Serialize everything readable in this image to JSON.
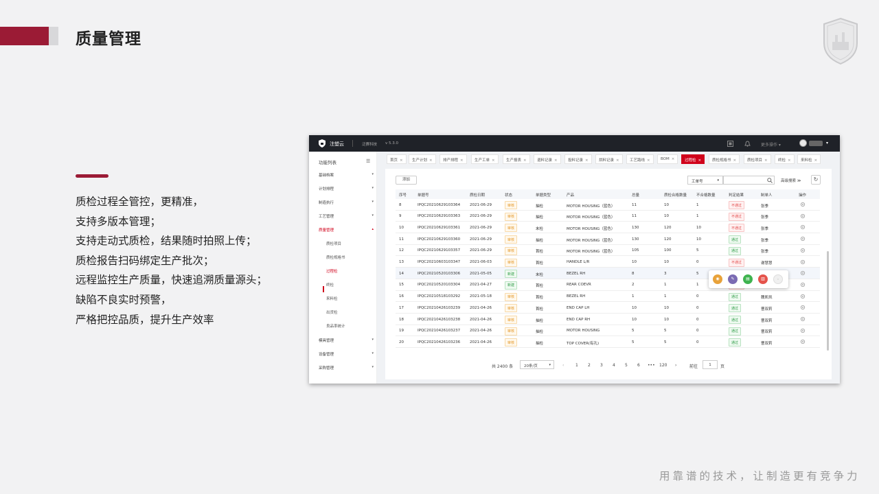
{
  "slide": {
    "title": "质量管理",
    "bullets": [
      "质检过程全管控，更精准，",
      "支持多版本管理；",
      "支持走动式质检，结果随时拍照上传；",
      "质检报告扫码绑定生产批次；",
      "远程监控生产质量，快速追溯质量源头；",
      "缺陷不良实时预警，",
      "严格把控品质，提升生产效率"
    ],
    "slogan": "用靠谱的技术，让制造更有竞争力",
    "accent_color": "#9b1b35"
  },
  "app": {
    "brand": "注塑云",
    "company": "泛赛科技",
    "version": "v 5.3.0",
    "more_actions": "更多操作 ▾",
    "sidebar": {
      "header": "功能列表",
      "fold_icon": "menu-fold-icon",
      "items": [
        "基础档案",
        "计划排程",
        "制造执行",
        "工艺管理",
        "质量管理"
      ],
      "quality_sub": [
        "质检项目",
        "质检规格书",
        "过程检",
        "终检",
        "来料检",
        "出货检",
        "良品率统计"
      ],
      "items_after": [
        "模具管理",
        "设备管理",
        "采购管理"
      ]
    },
    "tabs": [
      "首页",
      "生产计划",
      "排产排程",
      "生产工单",
      "生产报表",
      "退料记录",
      "投料记录",
      "烘料记录",
      "工艺路线",
      "BOM",
      "过程检",
      "质检规格书",
      "质检项目",
      "终检",
      "来料检"
    ],
    "active_tab": "过程检",
    "toolbar": {
      "add_label": "添加",
      "filter_field": "工单号",
      "advanced_search": "高级搜索  ≫"
    },
    "columns": [
      "序号",
      "单据号",
      "质检日期",
      "状态",
      "单据类型",
      "产品",
      "总量",
      "质检合格数量",
      "不合格数量",
      "判定结果",
      "制单人",
      "操作"
    ],
    "rows": [
      {
        "no": "8",
        "doc": "IPQC20210629103364",
        "date": "2021-06-29",
        "status": "审核",
        "type": "抽检",
        "product": "MOTOR HOUSING（蓝色）",
        "total": "11",
        "pass": "10",
        "fail": "1",
        "result": "不通过",
        "maker": "张季"
      },
      {
        "no": "9",
        "doc": "IPQC20210629103363",
        "date": "2021-06-29",
        "status": "审核",
        "type": "抽检",
        "product": "MOTOR HOUSING（蓝色）",
        "total": "11",
        "pass": "10",
        "fail": "1",
        "result": "不通过",
        "maker": "张季"
      },
      {
        "no": "10",
        "doc": "IPQC20210629103361",
        "date": "2021-06-29",
        "status": "审核",
        "type": "末检",
        "product": "MOTOR HOUSING（蓝色）",
        "total": "130",
        "pass": "120",
        "fail": "10",
        "result": "不通过",
        "maker": "张季"
      },
      {
        "no": "11",
        "doc": "IPQC20210629103360",
        "date": "2021-06-29",
        "status": "审核",
        "type": "抽检",
        "product": "MOTOR HOUSING（蓝色）",
        "total": "130",
        "pass": "120",
        "fail": "10",
        "result": "通过",
        "maker": "张季"
      },
      {
        "no": "12",
        "doc": "IPQC20210629103357",
        "date": "2021-06-29",
        "status": "审核",
        "type": "首检",
        "product": "MOTOR HOUSING（蓝色）",
        "total": "105",
        "pass": "100",
        "fail": "5",
        "result": "通过",
        "maker": "张季"
      },
      {
        "no": "13",
        "doc": "IPQC20210603103347",
        "date": "2021-06-03",
        "status": "审核",
        "type": "首检",
        "product": "HANDLE L/R",
        "total": "10",
        "pass": "10",
        "fail": "0",
        "result": "不通过",
        "maker": "谢慧慧"
      },
      {
        "no": "14",
        "doc": "IPQC20210520103306",
        "date": "2021-05-05",
        "status": "新建",
        "type": "末检",
        "product": "BEZEL RH",
        "total": "8",
        "pass": "3",
        "fail": "5",
        "result": "",
        "maker": ""
      },
      {
        "no": "15",
        "doc": "IPQC20210520103304",
        "date": "2021-04-27",
        "status": "新建",
        "type": "首检",
        "product": "REAR COEVR",
        "total": "2",
        "pass": "1",
        "fail": "1",
        "result": "不通过",
        "maker": "孙文军"
      },
      {
        "no": "16",
        "doc": "IPQC20210518103292",
        "date": "2021-05-18",
        "status": "审核",
        "type": "首检",
        "product": "BEZEL RH",
        "total": "1",
        "pass": "1",
        "fail": "0",
        "result": "通过",
        "maker": "魏凯凯"
      },
      {
        "no": "17",
        "doc": "IPQC20210426103239",
        "date": "2021-04-26",
        "status": "审核",
        "type": "首检",
        "product": "END CAP LH",
        "total": "10",
        "pass": "10",
        "fail": "0",
        "result": "通过",
        "maker": "曹双莉"
      },
      {
        "no": "18",
        "doc": "IPQC20210426103238",
        "date": "2021-04-26",
        "status": "审核",
        "type": "抽检",
        "product": "END CAP RH",
        "total": "10",
        "pass": "10",
        "fail": "0",
        "result": "通过",
        "maker": "曹双莉"
      },
      {
        "no": "19",
        "doc": "IPQC20210426103237",
        "date": "2021-04-26",
        "status": "审核",
        "type": "抽检",
        "product": "MOTOR HOUSING",
        "total": "5",
        "pass": "5",
        "fail": "0",
        "result": "通过",
        "maker": "曹双莉"
      },
      {
        "no": "20",
        "doc": "IPQC20210426103236",
        "date": "2021-04-26",
        "status": "审核",
        "type": "抽检",
        "product": "TOP COVER(有孔)",
        "total": "5",
        "pass": "5",
        "fail": "0",
        "result": "通过",
        "maker": "曹双莉"
      }
    ],
    "popover_actions": [
      {
        "icon": "view-icon",
        "color": "#e8a23a"
      },
      {
        "icon": "edit-icon",
        "color": "#7b6bb3"
      },
      {
        "icon": "document-icon",
        "color": "#3fb34f"
      },
      {
        "icon": "delete-icon",
        "color": "#e5534b"
      },
      {
        "icon": "more-icon",
        "color": "#dcdcdc"
      }
    ],
    "pagination": {
      "total": "共 2400 条",
      "page_size": "20条/页",
      "pages": [
        "1",
        "2",
        "3",
        "4",
        "5",
        "6",
        "•••",
        "120"
      ],
      "goto_label": "前往",
      "goto_value": "1",
      "page_suffix": "页",
      "prev": "‹",
      "next": "›"
    }
  }
}
